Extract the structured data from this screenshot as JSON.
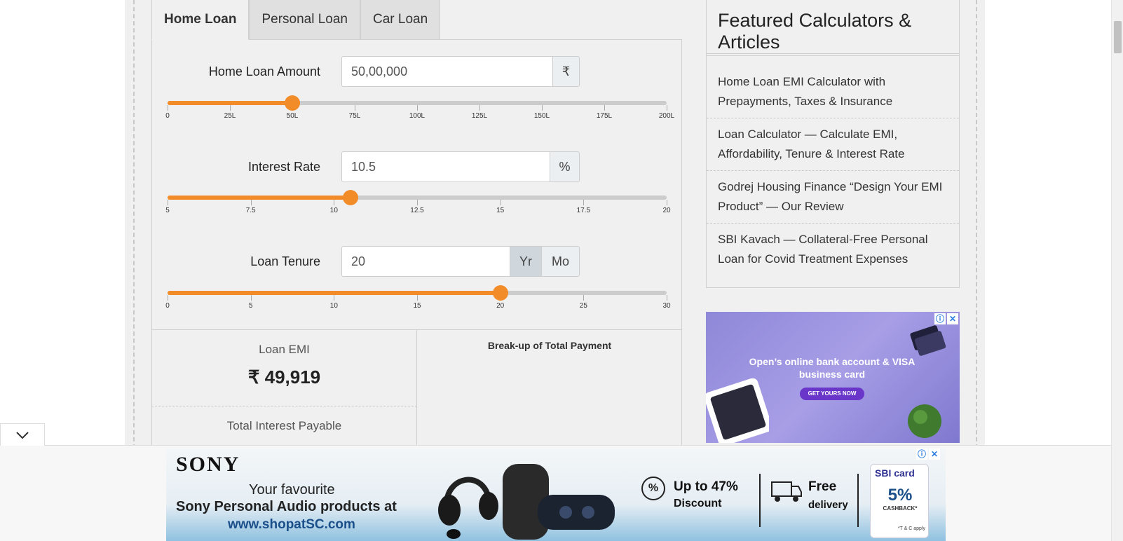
{
  "tabs": [
    {
      "label": "Home Loan",
      "active": true
    },
    {
      "label": "Personal Loan",
      "active": false
    },
    {
      "label": "Car Loan",
      "active": false
    }
  ],
  "loan_amount": {
    "label": "Home Loan Amount",
    "value": "50,00,000",
    "unit": "₹",
    "slider_value": 50,
    "slider_min": 0,
    "slider_max": 200,
    "ticks": [
      "0",
      "25L",
      "50L",
      "75L",
      "100L",
      "125L",
      "150L",
      "175L",
      "200L"
    ]
  },
  "interest_rate": {
    "label": "Interest Rate",
    "value": "10.5",
    "unit": "%",
    "slider_value": 10.5,
    "slider_min": 5,
    "slider_max": 20,
    "ticks": [
      "5",
      "7.5",
      "10",
      "12.5",
      "15",
      "17.5",
      "20"
    ]
  },
  "loan_tenure": {
    "label": "Loan Tenure",
    "value": "20",
    "unit_year": "Yr",
    "unit_month": "Mo",
    "selected_unit": "Yr",
    "slider_value": 20,
    "slider_min": 0,
    "slider_max": 30,
    "ticks": [
      "0",
      "5",
      "10",
      "15",
      "20",
      "25",
      "30"
    ]
  },
  "results": {
    "emi_label": "Loan EMI",
    "emi_value": "₹ 49,919",
    "interest_label": "Total Interest Payable",
    "chart_title": "Break-up of Total Payment"
  },
  "featured": {
    "title": "Featured Calculators & Articles",
    "articles": [
      "Home Loan EMI Calculator with Prepayments, Taxes & Insurance",
      "Loan Calculator — Calculate EMI, Affordability, Tenure & Interest Rate",
      "Godrej Housing Finance “Design Your EMI Product” — Our Review",
      "SBI Kavach — Collateral-Free Personal Loan for Covid Treatment Expenses"
    ]
  },
  "side_ad": {
    "headline": "Open’s online bank account & VISA business card",
    "button": "GET YOURS NOW"
  },
  "bottom_ad": {
    "brand": "SONY",
    "line1": "Your favourite",
    "line2": "Sony Personal Audio products at",
    "line3": "www.shopatSC.com",
    "promo1_title": "Up to 47%",
    "promo1_sub": "Discount",
    "promo2_title": "Free",
    "promo2_sub": "delivery",
    "card_brand": "SBI card",
    "card_pct": "5%",
    "card_cashback": "CASHBACK*",
    "card_tc": "*T & C apply"
  },
  "colors": {
    "accent": "#f28c28",
    "track": "#cccccc",
    "panel": "#f0f0f0"
  },
  "icons": {
    "ad_info": "info-icon",
    "ad_close": "close-icon",
    "collapse": "chevron-down-icon"
  }
}
